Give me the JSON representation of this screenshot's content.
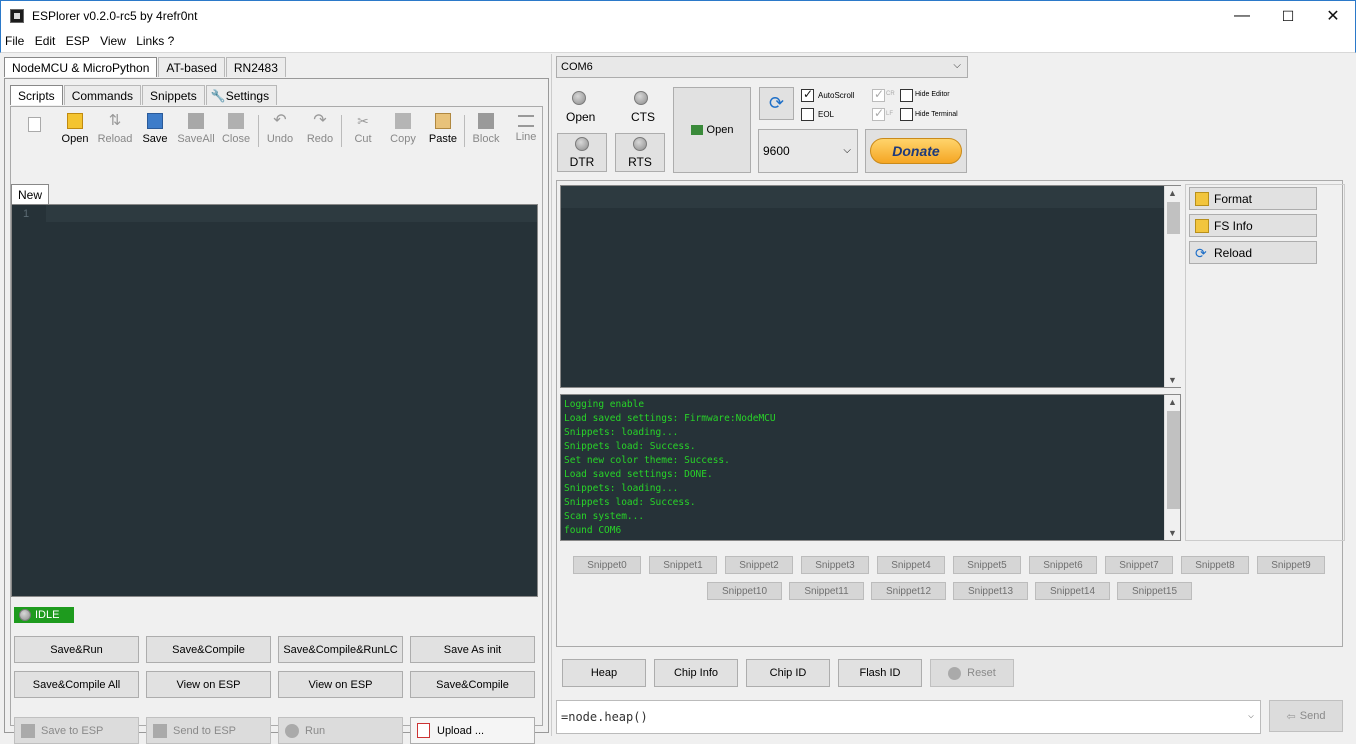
{
  "window": {
    "title": "ESPlorer v0.2.0-rc5 by 4refr0nt",
    "minimize": "—",
    "maximize": "☐",
    "close": "✕"
  },
  "menu": [
    "File",
    "Edit",
    "ESP",
    "View",
    "Links ?"
  ],
  "firmware_tabs": [
    "NodeMCU & MicroPython",
    "AT-based",
    "RN2483"
  ],
  "sub_tabs": [
    "Scripts",
    "Commands",
    "Snippets",
    "Settings"
  ],
  "toolbar": {
    "open": "Open",
    "reload": "Reload",
    "save": "Save",
    "saveall": "SaveAll",
    "close": "Close",
    "undo": "Undo",
    "redo": "Redo",
    "cut": "Cut",
    "copy": "Copy",
    "paste": "Paste",
    "block": "Block",
    "line": "Line"
  },
  "editor": {
    "tab": "New",
    "line_number": "1"
  },
  "status": "IDLE",
  "actions_row1": [
    "Save&Run",
    "Save&Compile",
    "Save&Compile&RunLC",
    "Save As init"
  ],
  "actions_row2": [
    "Save&Compile All",
    "View on ESP",
    "View on ESP",
    "Save&Compile"
  ],
  "actions_row3": [
    "Save to ESP",
    "Send to ESP",
    "Run",
    "Upload ..."
  ],
  "serial": {
    "port": "COM6",
    "open_led": "Open",
    "cts_led": "CTS",
    "dtr_btn": "DTR",
    "rts_btn": "RTS",
    "open_btn": "Open",
    "baud": "9600",
    "donate": "Donate",
    "autoscroll": "AutoScroll",
    "eol": "EOL",
    "cr": "CR",
    "lf": "LF",
    "hide_editor": "Hide Editor",
    "hide_terminal": "Hide Terminal"
  },
  "side_buttons": [
    "Format",
    "FS Info",
    "Reload"
  ],
  "log_lines": [
    "Logging enable",
    "Load saved settings: Firmware:NodeMCU",
    "Snippets: loading...",
    "Snippets load: Success.",
    "Set new color theme: Success.",
    "Load saved settings: DONE.",
    "Snippets: loading...",
    "Snippets load: Success.",
    "Scan system...",
    "found COM6"
  ],
  "snippets_row1": [
    "Snippet0",
    "Snippet1",
    "Snippet2",
    "Snippet3",
    "Snippet4",
    "Snippet5",
    "Snippet6",
    "Snippet7",
    "Snippet8",
    "Snippet9"
  ],
  "snippets_row2": [
    "Snippet10",
    "Snippet11",
    "Snippet12",
    "Snippet13",
    "Snippet14",
    "Snippet15"
  ],
  "bottom_buttons": [
    "Heap",
    "Chip Info",
    "Chip ID",
    "Flash ID",
    "Reset"
  ],
  "command": {
    "value": "=node.heap()",
    "send": "Send"
  },
  "colors": {
    "editor_bg": "#263238",
    "log_text": "#28d428",
    "status_green": "#1e9b1e",
    "accent": "#2b79c9"
  }
}
